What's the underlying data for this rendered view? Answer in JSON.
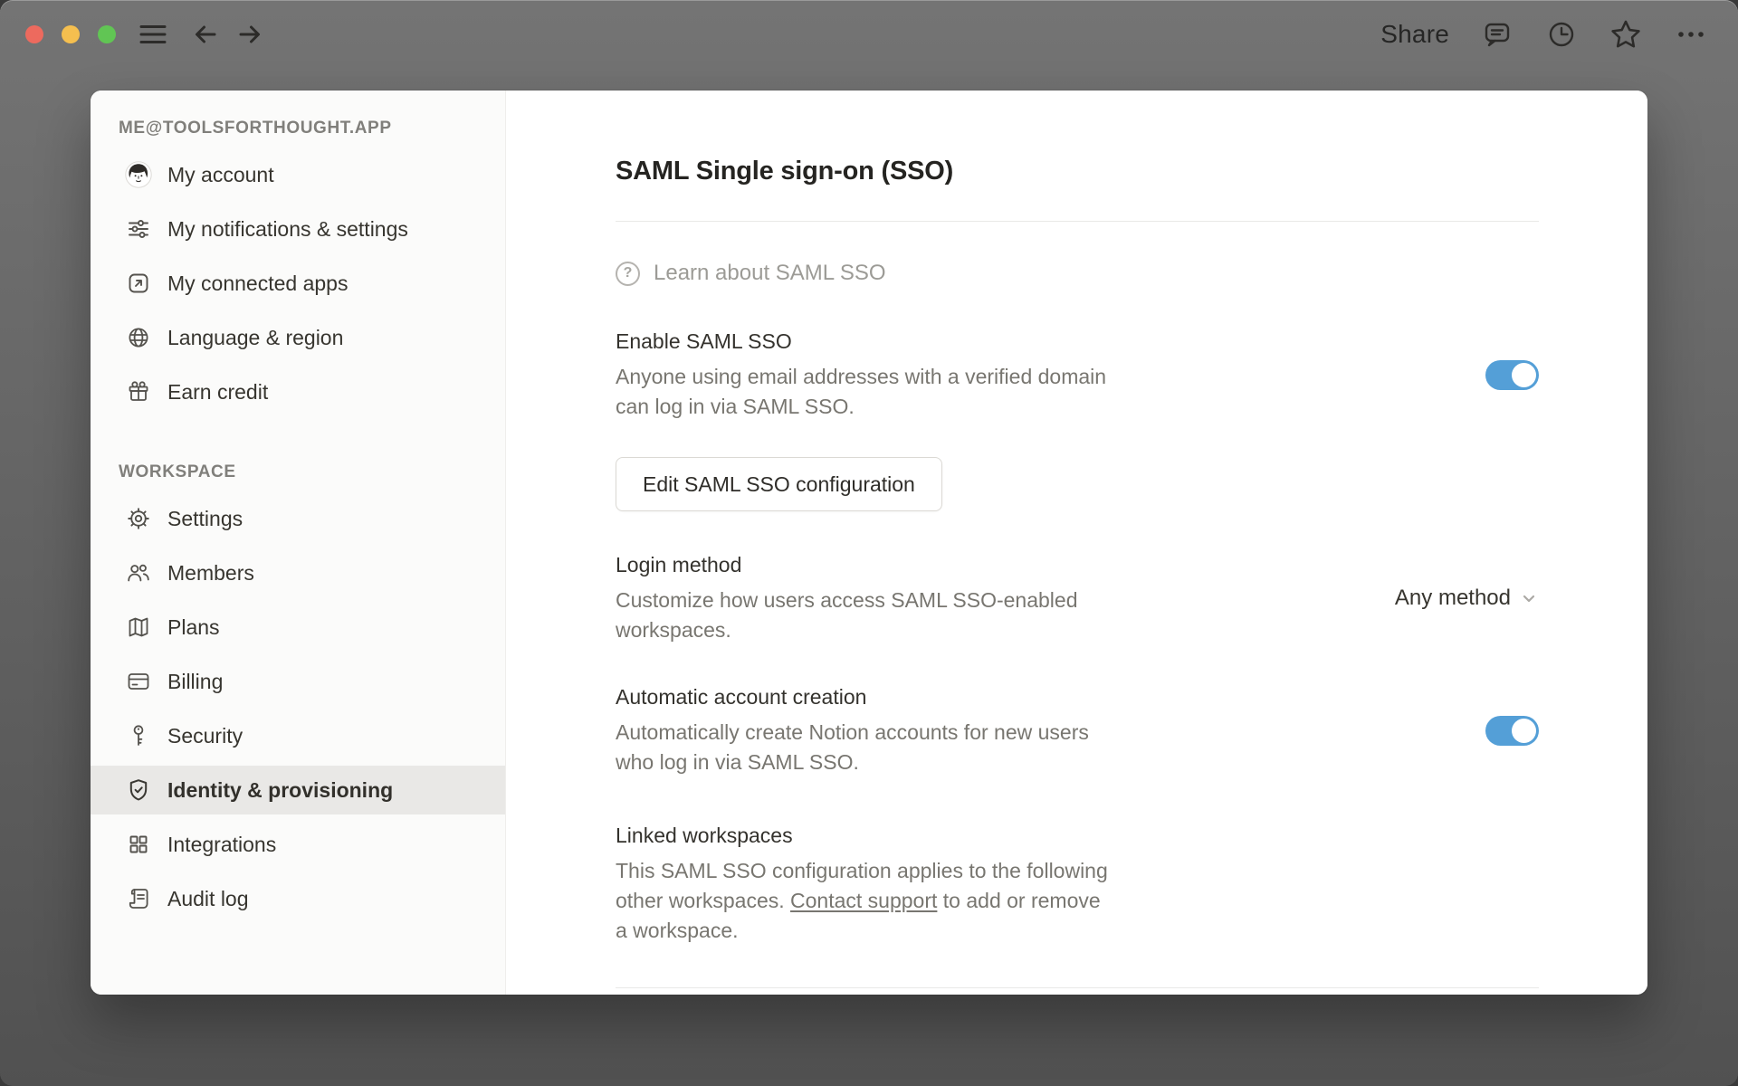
{
  "topbar": {
    "share_label": "Share",
    "icons": [
      "hamburger-icon",
      "back-arrow-icon",
      "forward-arrow-icon",
      "comment-icon",
      "history-clock-icon",
      "star-icon",
      "ellipsis-icon"
    ],
    "traffic_lights": {
      "close": "#ed6a5e",
      "minimize": "#f5bf4f",
      "zoom": "#61c554"
    }
  },
  "sidebar": {
    "account_header": "ME@TOOLSFORTHOUGHT.APP",
    "account_items": [
      {
        "label": "My account",
        "icon": "avatar"
      },
      {
        "label": "My notifications & settings",
        "icon": "sliders-icon"
      },
      {
        "label": "My connected apps",
        "icon": "arrow-up-right-square-icon"
      },
      {
        "label": "Language & region",
        "icon": "globe-icon"
      },
      {
        "label": "Earn credit",
        "icon": "gift-icon"
      }
    ],
    "workspace_header": "WORKSPACE",
    "workspace_items": [
      {
        "label": "Settings",
        "icon": "gear-icon",
        "selected": false
      },
      {
        "label": "Members",
        "icon": "members-icon",
        "selected": false
      },
      {
        "label": "Plans",
        "icon": "map-icon",
        "selected": false
      },
      {
        "label": "Billing",
        "icon": "credit-card-icon",
        "selected": false
      },
      {
        "label": "Security",
        "icon": "key-icon",
        "selected": false
      },
      {
        "label": "Identity & provisioning",
        "icon": "shield-check-icon",
        "selected": true
      },
      {
        "label": "Integrations",
        "icon": "grid-icon",
        "selected": false
      },
      {
        "label": "Audit log",
        "icon": "audit-log-icon",
        "selected": false
      }
    ]
  },
  "content": {
    "title": "SAML Single sign-on (SSO)",
    "learn_link": "Learn about SAML SSO",
    "enable": {
      "heading": "Enable SAML SSO",
      "description": "Anyone using email addresses with a verified domain\ncan log in via SAML SSO.",
      "toggle_on": true
    },
    "edit_button_label": "Edit SAML SSO configuration",
    "login_method": {
      "heading": "Login method",
      "description": "Customize how users access SAML SSO-enabled\nworkspaces.",
      "selected_value": "Any method"
    },
    "auto_account": {
      "heading": "Automatic account creation",
      "description": "Automatically create Notion accounts for new users\nwho log in via SAML SSO.",
      "toggle_on": true
    },
    "linked_workspaces": {
      "heading": "Linked workspaces",
      "description_before": "This SAML SSO configuration applies to the following\nother workspaces. ",
      "link_text": "Contact support",
      "description_after": " to add or remove\na workspace."
    }
  },
  "colors": {
    "toggle_on": "#549fd7",
    "selected_row_bg": "#e9e8e6",
    "sidebar_bg": "#fbfbfa",
    "backdrop_top": "#747474",
    "backdrop_bottom": "#515151"
  }
}
